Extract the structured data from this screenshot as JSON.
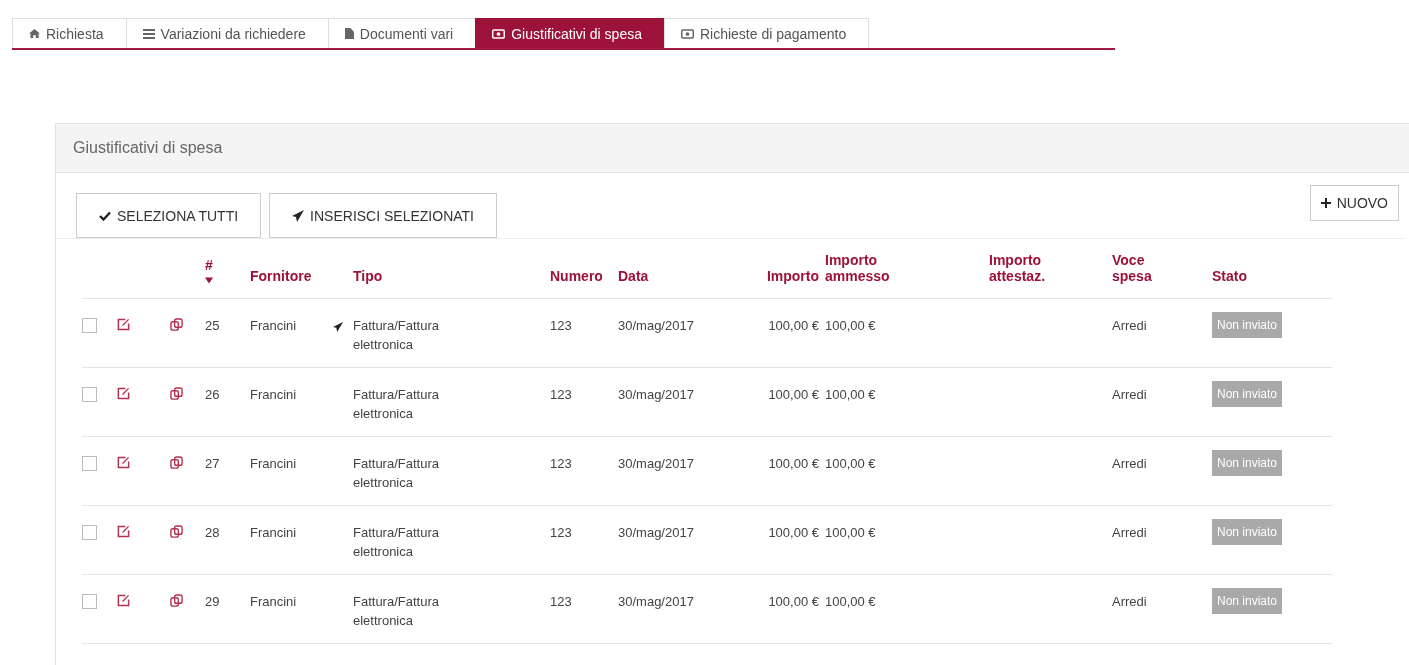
{
  "tabs": [
    {
      "label": "Richiesta",
      "selected": false
    },
    {
      "label": "Variazioni da richiedere",
      "selected": false
    },
    {
      "label": "Documenti vari",
      "selected": false
    },
    {
      "label": "Giustificativi di spesa",
      "selected": true
    },
    {
      "label": "Richieste di pagamento",
      "selected": false
    }
  ],
  "panel": {
    "title": "Giustificativi di spesa",
    "buttons": [
      {
        "label": "SELEZIONA TUTTI"
      },
      {
        "label": "INSERISCI SELEZIONATI"
      }
    ],
    "new_button": {
      "label": "NUOVO"
    },
    "table": {
      "columns": [
        {
          "label": "#"
        },
        {
          "label": "Fornitore"
        },
        {
          "label": "Tipo"
        },
        {
          "label": "Numero"
        },
        {
          "label": "Data"
        },
        {
          "label": "Importo"
        },
        {
          "label": "Importo ammesso"
        },
        {
          "label": "Importo attestaz."
        },
        {
          "label": "Voce spesa"
        },
        {
          "label": "Stato"
        }
      ],
      "rows": [
        {
          "checked": false,
          "id": "25",
          "fornitore": "Francini",
          "tipo": "Fattura/Fattura elettronica",
          "numero": "123",
          "data": "30/mag/2017",
          "importo": "100,00 €",
          "importo_ammesso": "100,00 €",
          "voce": "Arredi",
          "stato": "Non inviato"
        },
        {
          "checked": false,
          "id": "26",
          "fornitore": "Francini",
          "tipo": "Fattura/Fattura elettronica",
          "numero": "123",
          "data": "30/mag/2017",
          "importo": "100,00 €",
          "importo_ammesso": "100,00 €",
          "voce": "Arredi",
          "stato": "Non inviato"
        },
        {
          "checked": false,
          "id": "27",
          "fornitore": "Francini",
          "tipo": "Fattura/Fattura elettronica",
          "numero": "123",
          "data": "30/mag/2017",
          "importo": "100,00 €",
          "importo_ammesso": "100,00 €",
          "voce": "Arredi",
          "stato": "Non inviato"
        },
        {
          "checked": false,
          "id": "28",
          "fornitore": "Francini",
          "tipo": "Fattura/Fattura elettronica",
          "numero": "123",
          "data": "30/mag/2017",
          "importo": "100,00 €",
          "importo_ammesso": "100,00 €",
          "voce": "Arredi",
          "stato": "Non inviato"
        },
        {
          "checked": false,
          "id": "29",
          "fornitore": "Francini",
          "tipo": "Fattura/Fattura elettronica",
          "numero": "123",
          "data": "30/mag/2017",
          "importo": "100,00 €",
          "importo_ammesso": "100,00 €",
          "voce": "Arredi",
          "stato": "Non inviato"
        }
      ]
    }
  }
}
